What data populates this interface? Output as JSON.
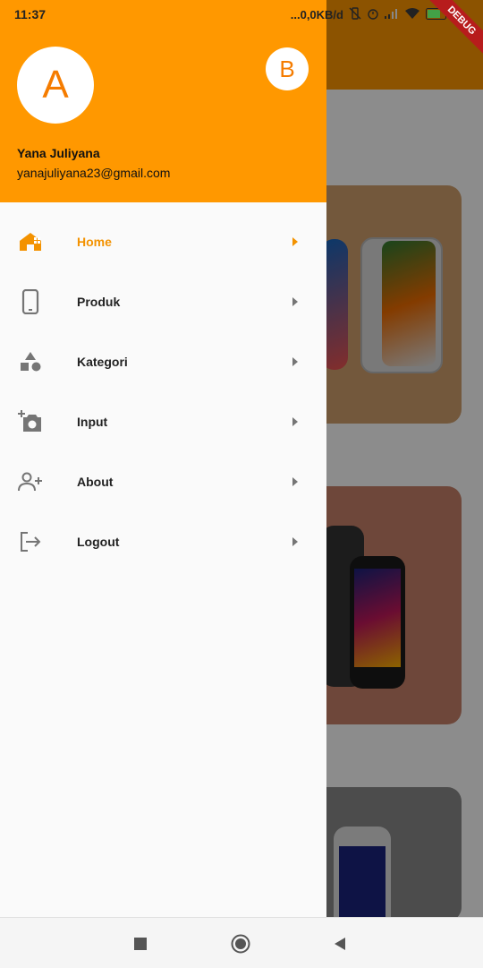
{
  "status_bar": {
    "time": "11:37",
    "speed": "...0,0KB/d",
    "icons": [
      "vibrate-off-icon",
      "alarm-icon",
      "signal-icon",
      "wifi-icon",
      "battery-icon",
      "charging-icon"
    ]
  },
  "debug_banner": "DEBUG",
  "drawer": {
    "header": {
      "avatar_letter": "A",
      "secondary_avatar_letter": "B",
      "name": "Yana Juliyana",
      "email": "yanajuliyana23@gmail.com"
    },
    "items": [
      {
        "label": "Home",
        "icon": "home-icon",
        "active": true
      },
      {
        "label": "Produk",
        "icon": "smartphone-icon",
        "active": false
      },
      {
        "label": "Kategori",
        "icon": "category-icon",
        "active": false
      },
      {
        "label": "Input",
        "icon": "add-photo-icon",
        "active": false
      },
      {
        "label": "About",
        "icon": "person-add-icon",
        "active": false
      },
      {
        "label": "Logout",
        "icon": "logout-icon",
        "active": false
      }
    ]
  },
  "colors": {
    "primary": "#ff9800",
    "active_text": "#f39200",
    "icon_grey": "#757575"
  },
  "nav_bar": {
    "buttons": [
      "recent-apps-icon",
      "home-button-icon",
      "back-icon"
    ]
  }
}
